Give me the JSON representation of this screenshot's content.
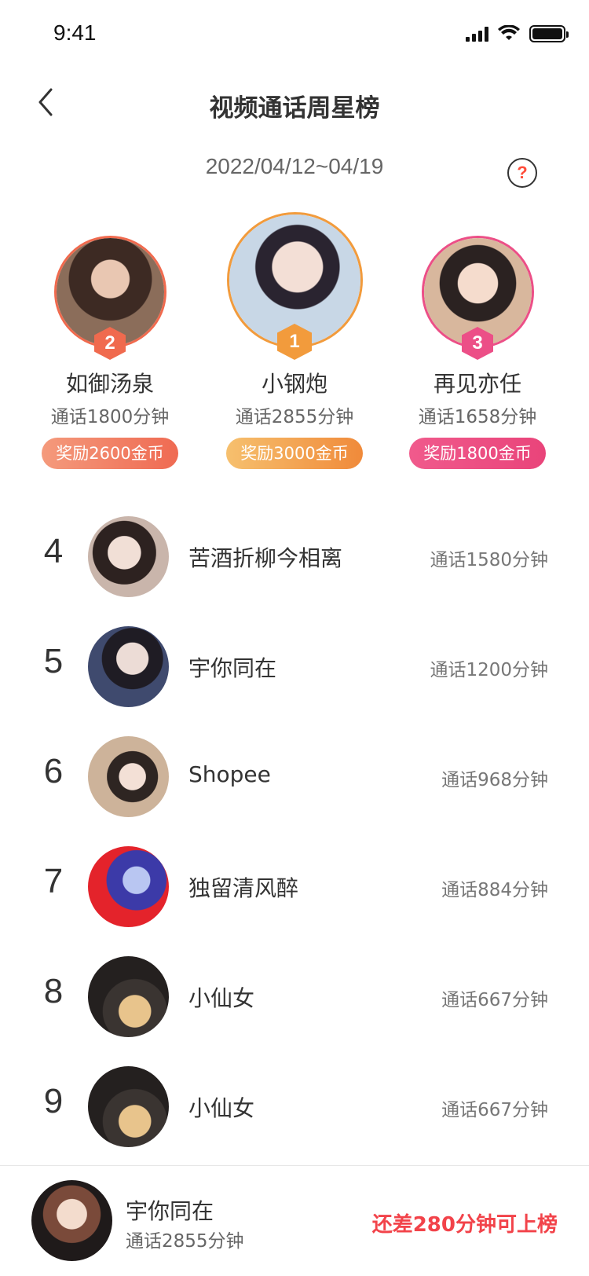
{
  "status_bar": {
    "time": "9:41"
  },
  "header": {
    "title": "视频通话周星榜"
  },
  "date_range": "2022/04/12~04/19",
  "help_icon": "help-circle-icon",
  "podium": [
    {
      "rank": "2",
      "name": "如御汤泉",
      "minutes": "通话1800分钟",
      "reward": "奖励2600金币",
      "color": "#f06a4e",
      "reward_from": "#f49a7c",
      "reward_to": "#ef6a52",
      "avatar_bg": [
        "#5a4237",
        "#c79a80"
      ]
    },
    {
      "rank": "1",
      "name": "小钢炮",
      "minutes": "通话2855分钟",
      "reward": "奖励3000金币",
      "color": "#f29b3c",
      "reward_from": "#f6c06e",
      "reward_to": "#f08a3a",
      "avatar_bg": [
        "#cfe0ee",
        "#8fa6c4"
      ]
    },
    {
      "rank": "3",
      "name": "再见亦任",
      "minutes": "通话1658分钟",
      "reward": "奖励1800金币",
      "color": "#ec4f87",
      "reward_from": "#f05a8c",
      "reward_to": "#e9447a",
      "avatar_bg": [
        "#e9cbb8",
        "#7a5a48"
      ]
    }
  ],
  "ranking": [
    {
      "rank": "4",
      "name": "苦酒折柳今相离",
      "minutes": "通话1580分钟",
      "avatar_bg": [
        "#d9c6bd",
        "#3b2c29"
      ]
    },
    {
      "rank": "5",
      "name": "宇你同在",
      "minutes": "通话1200分钟",
      "avatar_bg": [
        "#e7d7d3",
        "#3a4260"
      ]
    },
    {
      "rank": "6",
      "name": "Shopee",
      "minutes": "通话968分钟",
      "avatar_bg": [
        "#d9c1a6",
        "#6e5a4f"
      ]
    },
    {
      "rank": "7",
      "name": "独留清风醉",
      "minutes": "通话884分钟",
      "avatar_bg": [
        "#e4232b",
        "#3c3aa8"
      ]
    },
    {
      "rank": "8",
      "name": "小仙女",
      "minutes": "通话667分钟",
      "avatar_bg": [
        "#2f2b2a",
        "#e8c48c"
      ]
    },
    {
      "rank": "9",
      "name": "小仙女",
      "minutes": "通话667分钟",
      "avatar_bg": [
        "#2f2b2a",
        "#e8c48c"
      ]
    }
  ],
  "footer": {
    "name": "宇你同在",
    "minutes": "通话2855分钟",
    "gap_text": "还差280分钟可上榜",
    "gap_color": "#f2434a",
    "avatar_bg": [
      "#e8d2c2",
      "#6b3f33"
    ]
  }
}
